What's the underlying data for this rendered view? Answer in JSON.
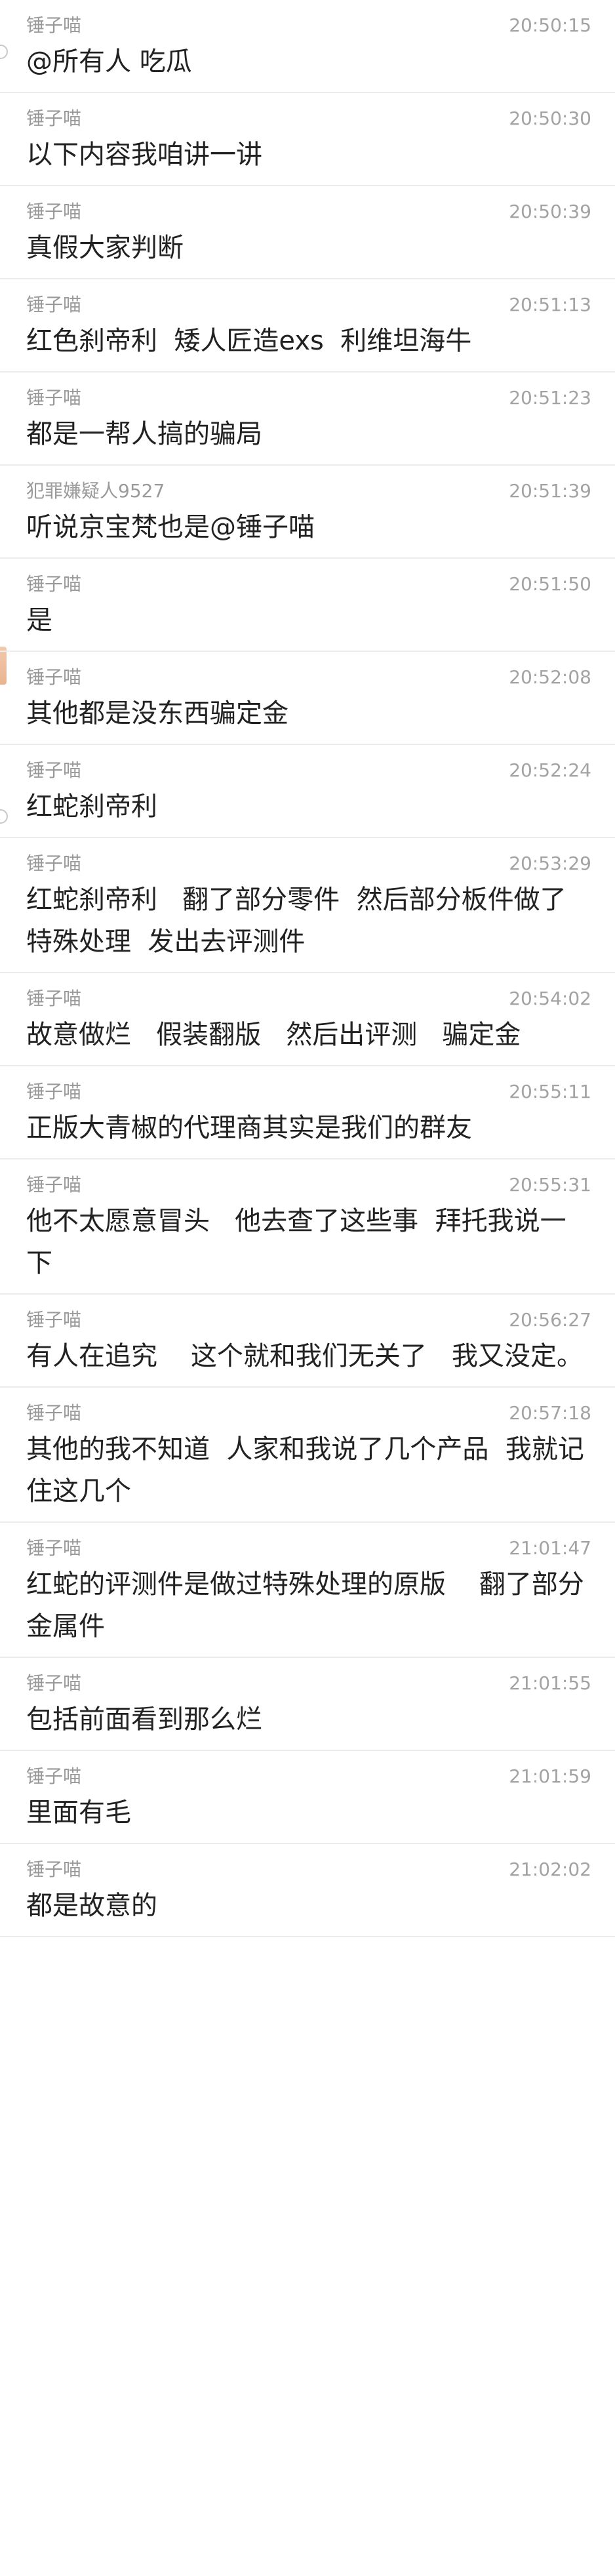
{
  "messages": [
    {
      "sender": "锤子喵",
      "time": "20:50:15",
      "text": "@所有人 吃瓜"
    },
    {
      "sender": "锤子喵",
      "time": "20:50:30",
      "text": "以下内容我咱讲一讲"
    },
    {
      "sender": "锤子喵",
      "time": "20:50:39",
      "text": "真假大家判断"
    },
    {
      "sender": "锤子喵",
      "time": "20:51:13",
      "text": "红色刹帝利  矮人匠造exs  利维坦海牛"
    },
    {
      "sender": "锤子喵",
      "time": "20:51:23",
      "text": "都是一帮人搞的骗局"
    },
    {
      "sender": "犯罪嫌疑人9527",
      "time": "20:51:39",
      "text": "听说京宝梵也是@锤子喵"
    },
    {
      "sender": "锤子喵",
      "time": "20:51:50",
      "text": "是"
    },
    {
      "sender": "锤子喵",
      "time": "20:52:08",
      "text": "其他都是没东西骗定金"
    },
    {
      "sender": "锤子喵",
      "time": "20:52:24",
      "text": "红蛇刹帝利"
    },
    {
      "sender": "锤子喵",
      "time": "20:53:29",
      "text": "红蛇刹帝利   翻了部分零件  然后部分板件做了特殊处理  发出去评测件"
    },
    {
      "sender": "锤子喵",
      "time": "20:54:02",
      "text": "故意做烂   假装翻版   然后出评测   骗定金"
    },
    {
      "sender": "锤子喵",
      "time": "20:55:11",
      "text": "正版大青椒的代理商其实是我们的群友"
    },
    {
      "sender": "锤子喵",
      "time": "20:55:31",
      "text": "他不太愿意冒头   他去查了这些事  拜托我说一下"
    },
    {
      "sender": "锤子喵",
      "time": "20:56:27",
      "text": "有人在追究    这个就和我们无关了   我又没定。"
    },
    {
      "sender": "锤子喵",
      "time": "20:57:18",
      "text": "其他的我不知道  人家和我说了几个产品  我就记住这几个"
    },
    {
      "sender": "锤子喵",
      "time": "21:01:47",
      "text": "红蛇的评测件是做过特殊处理的原版    翻了部分金属件"
    },
    {
      "sender": "锤子喵",
      "time": "21:01:55",
      "text": "包括前面看到那么烂"
    },
    {
      "sender": "锤子喵",
      "time": "21:01:59",
      "text": "里面有毛"
    },
    {
      "sender": "锤子喵",
      "time": "21:02:02",
      "text": "都是故意的"
    }
  ]
}
